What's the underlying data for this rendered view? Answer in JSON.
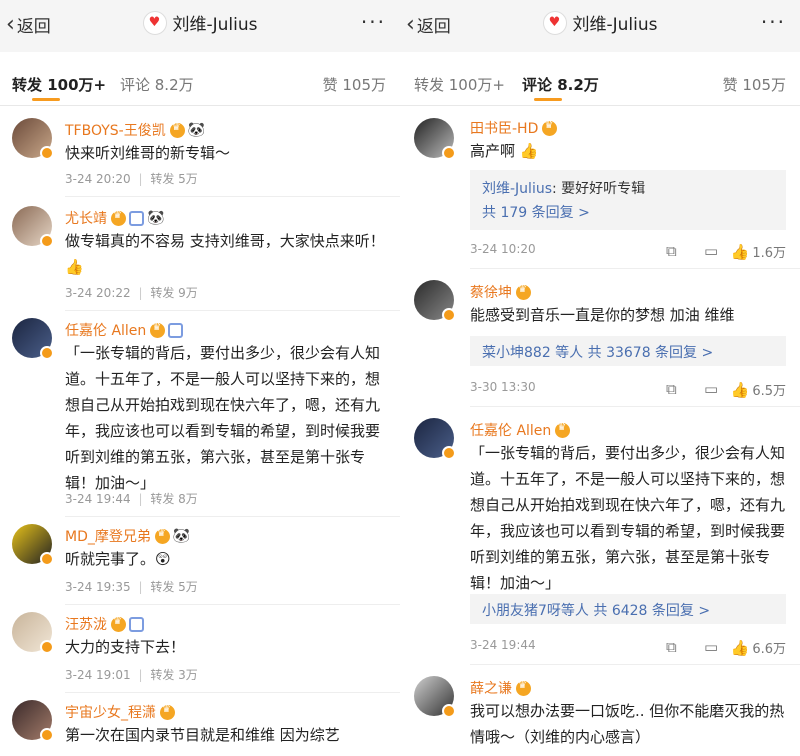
{
  "header": {
    "back_label": "返回",
    "title": "刘维-Julius",
    "more": "···"
  },
  "left": {
    "tabs": {
      "repost": "转发 100万+",
      "comment": "评论 8.2万",
      "like": "赞 105万"
    },
    "items": [
      {
        "name": "TFBOYS-王俊凯",
        "content": "快来听刘维哥的新专辑～",
        "time": "3-24 20:20",
        "repost": "转发 5万"
      },
      {
        "name": "尤长靖",
        "content": "做专辑真的不容易 支持刘维哥，大家快点来听！👍",
        "time": "3-24 20:22",
        "repost": "转发 9万"
      },
      {
        "name": "任嘉伦 Allen",
        "content": "「一张专辑的背后，要付出多少，很少会有人知道。十五年了，不是一般人可以坚持下来的，想想自己从开始拍戏到现在快六年了，嗯，还有九年，我应该也可以看到专辑的希望，到时候我要听到刘维的第五张，第六张，甚至是第十张专辑！加油～」",
        "time": "3-24 19:44",
        "repost": "转发 8万"
      },
      {
        "name": "MD_摩登兄弟",
        "content": "听就完事了。😲",
        "time": "3-24 19:35",
        "repost": "转发 5万"
      },
      {
        "name": "汪苏泷",
        "content": "大力的支持下去！",
        "time": "3-24 19:01",
        "repost": "转发 3万"
      },
      {
        "name": "宇宙少女_程潇",
        "content": "第一次在国内录节目就是和维维  因为综艺"
      }
    ]
  },
  "right": {
    "tabs": {
      "repost": "转发 100万+",
      "comment": "评论 8.2万",
      "like": "赞 105万"
    },
    "items": [
      {
        "name": "田书臣-HD",
        "content": "高产啊 👍",
        "reply_user": "刘维-Julius",
        "reply_text": ": 要好好听专辑",
        "reply_link": "共 179 条回复 >",
        "time": "3-24 10:20",
        "likes": "1.6万"
      },
      {
        "name": "蔡徐坤",
        "content": "能感受到音乐一直是你的梦想 加油 维维",
        "reply_user": "菜小坤882 等人",
        "reply_link": "共 33678 条回复 >",
        "time": "3-30 13:30",
        "likes": "6.5万"
      },
      {
        "name": "任嘉伦 Allen",
        "content": "「一张专辑的背后，要付出多少，很少会有人知道。十五年了，不是一般人可以坚持下来的，想想自己从开始拍戏到现在快六年了，嗯，还有九年，我应该也可以看到专辑的希望，到时候我要听到刘维的第五张，第六张，甚至是第十张专辑！加油～」",
        "reply_user": "小朋友猪7呀等人",
        "reply_link": "共 6428 条回复 >",
        "time": "3-24 19:44",
        "likes": "6.6万"
      },
      {
        "name": "薛之谦",
        "content": "我可以想办法要一口饭吃.. 但你不能磨灭我的热情哦～（刘维的内心感言）"
      }
    ]
  },
  "icons": {
    "share": "share-icon",
    "comment": "comment-icon",
    "like": "thumb-up-icon"
  },
  "colors": {
    "accent": "#f79b1f",
    "name": "#e8781f",
    "link": "#4a6fb0"
  }
}
